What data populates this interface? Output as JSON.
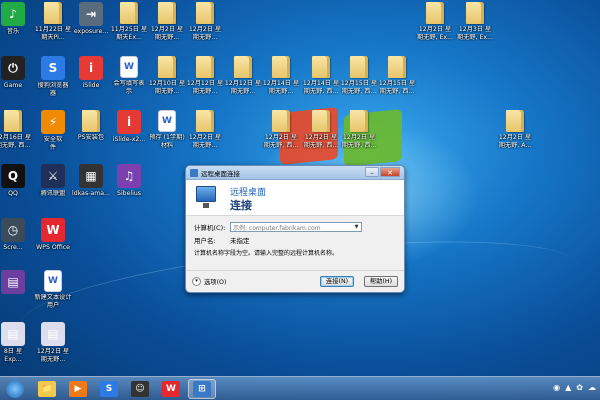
{
  "desktop": {
    "icons": [
      {
        "label": "音乐",
        "glyph": "♪",
        "color": "#22aa44",
        "kind": "app"
      },
      {
        "label": "11月22日 星",
        "label2": "期天Pi...",
        "kind": "folder"
      },
      {
        "label": "exposure...",
        "glyph": "⇥",
        "color": "#5a6b7d",
        "kind": "app"
      },
      {
        "label": "11月25日 星",
        "label2": "期天Ex...",
        "kind": "folder"
      },
      {
        "label": "12月2日 星",
        "label2": "期无野...",
        "kind": "folder"
      },
      {
        "label": "12月2日 星",
        "label2": "期无野...",
        "kind": "folder"
      },
      {
        "label": "12月2日 星",
        "label2": "期无野, Ex...",
        "kind": "folder"
      },
      {
        "label": "12月3日 星",
        "label2": "期无野, Ex...",
        "kind": "folder"
      },
      {
        "label": "Game",
        "glyph": "⏻",
        "color": "#222",
        "kind": "app"
      },
      {
        "label": "搜狗浏览器",
        "label2": "器",
        "glyph": "S",
        "color": "#2c7be5",
        "kind": "app"
      },
      {
        "label": "iSlide",
        "glyph": "i",
        "color": "#e53935",
        "kind": "app"
      },
      {
        "label": "会写填写表",
        "label2": "示",
        "glyph": "W",
        "kind": "doc"
      },
      {
        "label": "12月10日 星",
        "label2": "期无野...",
        "kind": "folder"
      },
      {
        "label": "12月12日 星",
        "label2": "期无野...",
        "kind": "folder"
      },
      {
        "label": "12月12日 星",
        "label2": "期无野...",
        "kind": "folder"
      },
      {
        "label": "12月14日 星",
        "label2": "期无野...",
        "kind": "folder"
      },
      {
        "label": "12月14日 星",
        "label2": "期无野, 西...",
        "kind": "folder"
      },
      {
        "label": "12月15日 星",
        "label2": "期无野, 西...",
        "kind": "folder"
      },
      {
        "label": "12月15日 星",
        "label2": "期无野, 西...",
        "kind": "folder"
      },
      {
        "label": "12月16日 星",
        "label2": "期无野, 西...",
        "kind": "folder"
      },
      {
        "label": "安全软",
        "label2": "件",
        "glyph": "⚡",
        "color": "#f08a00",
        "kind": "app"
      },
      {
        "label": "PS安装包",
        "kind": "folder"
      },
      {
        "label": "iSlide-x2...",
        "glyph": "i",
        "color": "#e53935",
        "kind": "app"
      },
      {
        "label": "预存 (1学期)",
        "label2": "材料",
        "glyph": "W",
        "kind": "doc"
      },
      {
        "label": "12月2日 星",
        "label2": "期无野...",
        "kind": "folder"
      },
      {
        "label": "12月2日 星",
        "label2": "期无野, 西...",
        "kind": "folder"
      },
      {
        "label": "12月2日 星",
        "label2": "期无野, 西...",
        "kind": "folder"
      },
      {
        "label": "12月2日 星",
        "label2": "期无野, 西...",
        "kind": "folder"
      },
      {
        "label": "12月2日 星",
        "label2": "期无野, A...",
        "kind": "folder"
      },
      {
        "label": "QQ",
        "glyph": "Q",
        "color": "#111",
        "kind": "app"
      },
      {
        "label": "腾讯联盟",
        "glyph": "⚔",
        "color": "#1f2f57",
        "kind": "app"
      },
      {
        "label": "ldkas-ama...",
        "glyph": "▦",
        "color": "#333",
        "kind": "app"
      },
      {
        "label": "Sibelius",
        "glyph": "♫",
        "color": "#7b3fb0",
        "kind": "app"
      },
      {
        "label": "Scre...",
        "glyph": "◷",
        "color": "#3c4b5a",
        "kind": "app"
      },
      {
        "label": "WPS Office",
        "glyph": "W",
        "color": "#e5282f",
        "kind": "app"
      },
      {
        "label": "",
        "glyph": "▤",
        "color": "#6b3fa0",
        "kind": "app"
      },
      {
        "label": "新建文本设计",
        "label2": "用户",
        "glyph": "W",
        "kind": "doc"
      },
      {
        "label": "8日 星",
        "label2": "Exp...",
        "glyph": "▤",
        "color": "#dde",
        "kind": "app"
      },
      {
        "label": "12月2日 星",
        "label2": "期无野...",
        "glyph": "▤",
        "color": "#dde",
        "kind": "app"
      }
    ]
  },
  "dialog": {
    "title": "远程桌面连接",
    "subtitle": "远程桌面",
    "heading": "连接",
    "computer_label": "计算机(C):",
    "computer_placeholder": "示例: computer.fabrikam.com",
    "user_label": "用户名:",
    "user_value": "未指定",
    "hint": "计算机名称字段为空。请输入完整的远程计算机名称。",
    "options_label": "选项(O)",
    "connect_label": "连接(N)",
    "help_label": "帮助(H)",
    "minimize": "–",
    "close": "✕"
  },
  "taskbar": {
    "items": [
      {
        "name": "explorer",
        "glyph": "📁"
      },
      {
        "name": "media-player",
        "glyph": "▶"
      },
      {
        "name": "sogou",
        "glyph": "S"
      },
      {
        "name": "user-app",
        "glyph": "☺"
      },
      {
        "name": "wps",
        "glyph": "W"
      },
      {
        "name": "remote-desktop",
        "glyph": "⊞"
      }
    ],
    "tray_glyphs": [
      "◉",
      "▲",
      "✿",
      "☁"
    ]
  }
}
